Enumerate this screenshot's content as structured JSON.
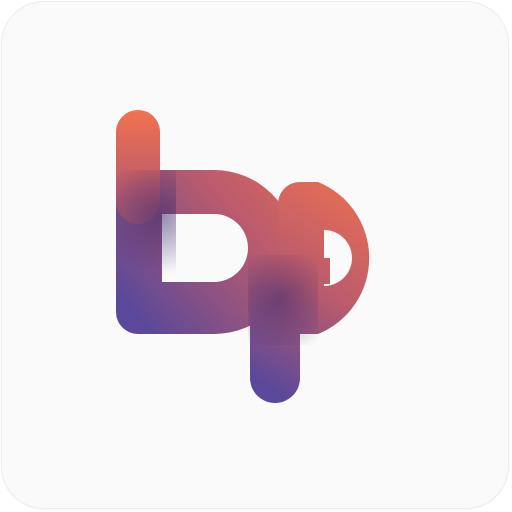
{
  "app_icon": {
    "logo_text": "bp",
    "colors": {
      "background": "#fafafa",
      "border": "#ececec",
      "gradient_start": "#f2724f",
      "gradient_mid": "#b85a6e",
      "gradient_end": "#5a489a",
      "shadow": "#3a2a6a"
    }
  }
}
